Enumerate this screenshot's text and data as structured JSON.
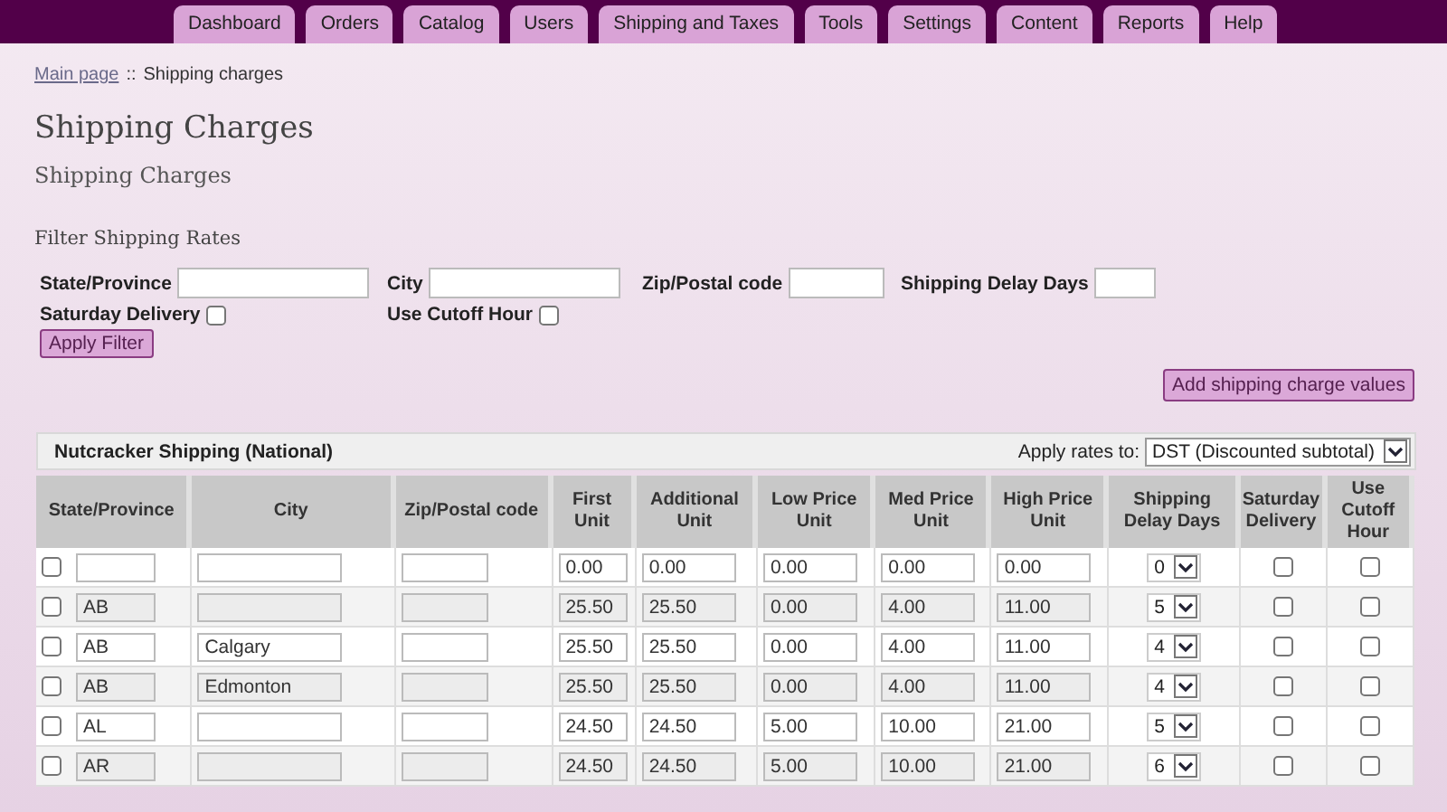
{
  "tabs": [
    {
      "label": "Dashboard"
    },
    {
      "label": "Orders"
    },
    {
      "label": "Catalog"
    },
    {
      "label": "Users"
    },
    {
      "label": "Shipping and Taxes"
    },
    {
      "label": "Tools"
    },
    {
      "label": "Settings"
    },
    {
      "label": "Content"
    },
    {
      "label": "Reports"
    },
    {
      "label": "Help"
    }
  ],
  "breadcrumb": {
    "link": "Main page",
    "separator": "::",
    "current": "Shipping charges"
  },
  "page_title": "Shipping Charges",
  "section_title": "Shipping Charges",
  "filter": {
    "title": "Filter Shipping Rates",
    "fields": [
      {
        "kind": "text",
        "label": "State/Province"
      },
      {
        "kind": "text",
        "label": "City"
      },
      {
        "kind": "text",
        "label": "Zip/Postal code"
      },
      {
        "kind": "text",
        "label": "Shipping Delay Days"
      },
      {
        "kind": "checkbox",
        "label": "Saturday Delivery",
        "checked": false
      },
      {
        "kind": "checkbox",
        "label": "Use Cutoff Hour",
        "checked": false
      }
    ],
    "apply_button": "Apply Filter"
  },
  "add_button": "Add shipping charge values",
  "table": {
    "title": "Nutcracker Shipping (National)",
    "apply_rates_label": "Apply rates to:",
    "apply_rates_value": "DST (Discounted subtotal)",
    "columns": [
      "State/Province",
      "City",
      "Zip/Postal code",
      "First Unit",
      "Additional Unit",
      "Low Price Unit",
      "Med Price Unit",
      "High Price Unit",
      "Shipping Delay Days",
      "Saturday Delivery",
      "Use Cutoff Hour"
    ],
    "rows": [
      {
        "selected": false,
        "first_unit": "0.00",
        "additional_unit": "0.00",
        "low_price_unit": "0.00",
        "med_price_unit": "0.00",
        "high_price_unit": "0.00",
        "delay_days": "0",
        "saturday_delivery": false,
        "use_cutoff_hour": false
      },
      {
        "selected": false,
        "state": "AB",
        "first_unit": "25.50",
        "additional_unit": "25.50",
        "low_price_unit": "0.00",
        "med_price_unit": "4.00",
        "high_price_unit": "11.00",
        "delay_days": "5",
        "saturday_delivery": false,
        "use_cutoff_hour": false
      },
      {
        "selected": false,
        "state": "AB",
        "city": "Calgary",
        "first_unit": "25.50",
        "additional_unit": "25.50",
        "low_price_unit": "0.00",
        "med_price_unit": "4.00",
        "high_price_unit": "11.00",
        "delay_days": "4",
        "saturday_delivery": false,
        "use_cutoff_hour": false
      },
      {
        "selected": false,
        "state": "AB",
        "city": "Edmonton",
        "first_unit": "25.50",
        "additional_unit": "25.50",
        "low_price_unit": "0.00",
        "med_price_unit": "4.00",
        "high_price_unit": "11.00",
        "delay_days": "4",
        "saturday_delivery": false,
        "use_cutoff_hour": false
      },
      {
        "selected": false,
        "state": "AL",
        "first_unit": "24.50",
        "additional_unit": "24.50",
        "low_price_unit": "5.00",
        "med_price_unit": "10.00",
        "high_price_unit": "21.00",
        "delay_days": "5",
        "saturday_delivery": false,
        "use_cutoff_hour": false
      },
      {
        "selected": false,
        "state": "AR",
        "first_unit": "24.50",
        "additional_unit": "24.50",
        "low_price_unit": "5.00",
        "med_price_unit": "10.00",
        "high_price_unit": "21.00",
        "delay_days": "6",
        "saturday_delivery": false,
        "use_cutoff_hour": false
      }
    ]
  }
}
